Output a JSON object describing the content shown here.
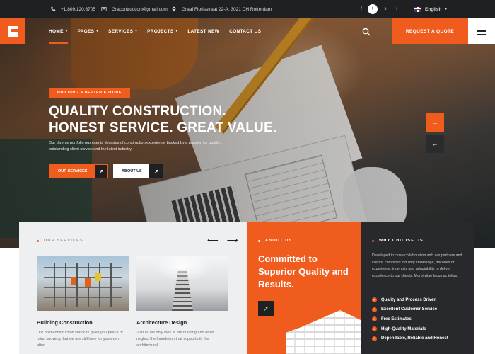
{
  "topbar": {
    "phone": "+1.809.120.6705",
    "email": "Gracontruction@gmail.com",
    "address": "Graaf Florisstraat 22-A, 3021 CH Rotterdam",
    "social": [
      "f",
      "t",
      "s",
      "i"
    ],
    "language": "English"
  },
  "nav": {
    "links": [
      "HOME",
      "PAGES",
      "SERVICES",
      "PROJECTS",
      "LATEST NEW",
      "CONTACT US"
    ],
    "quote_label": "REQUEST A QUOTE"
  },
  "hero": {
    "tagline": "BUILDING A BETTER FUTURE",
    "headline_1": "QUALITY CONSTRUCTION.",
    "headline_2": "HONEST SERVICE. GREAT VALUE.",
    "description": "Our diverse portfolio represents decades of construction experience backed by a passion for quality, outstanding client service and the latest industry.",
    "btn_services": "OUR SERVICES",
    "btn_about": "ABOUT US"
  },
  "services": {
    "label": "OUR SERVICES",
    "cards": [
      {
        "title": "Building Construction",
        "desc": "Our post-construction services gives you peace of mind knowing that we are still here for you even after."
      },
      {
        "title": "Architecture Design",
        "desc": "Just as we only look at the building and often neglect the foundation that supports it, the architectural"
      }
    ]
  },
  "about": {
    "label": "ABOUT US",
    "title": "Committed to Superior Quality and Results."
  },
  "why": {
    "label": "WHY CHOOSE US",
    "desc": "Developed in close collaboration with our partners and clients, combines industry knowledge, decades of experience, ingenuity and adaptability to deliver excellence to our clients. Morbi vitae lacus ac tellus.",
    "items": [
      "Quality and Process Driven",
      "Excellent Customer Service",
      "Free Estimates",
      "High-Quality Materials",
      "Dependable, Reliable and Honest"
    ]
  },
  "colors": {
    "accent": "#ef5c1e",
    "dark": "#1f2022",
    "panel_dark": "#27292c",
    "panel_light": "#eeeff0"
  }
}
